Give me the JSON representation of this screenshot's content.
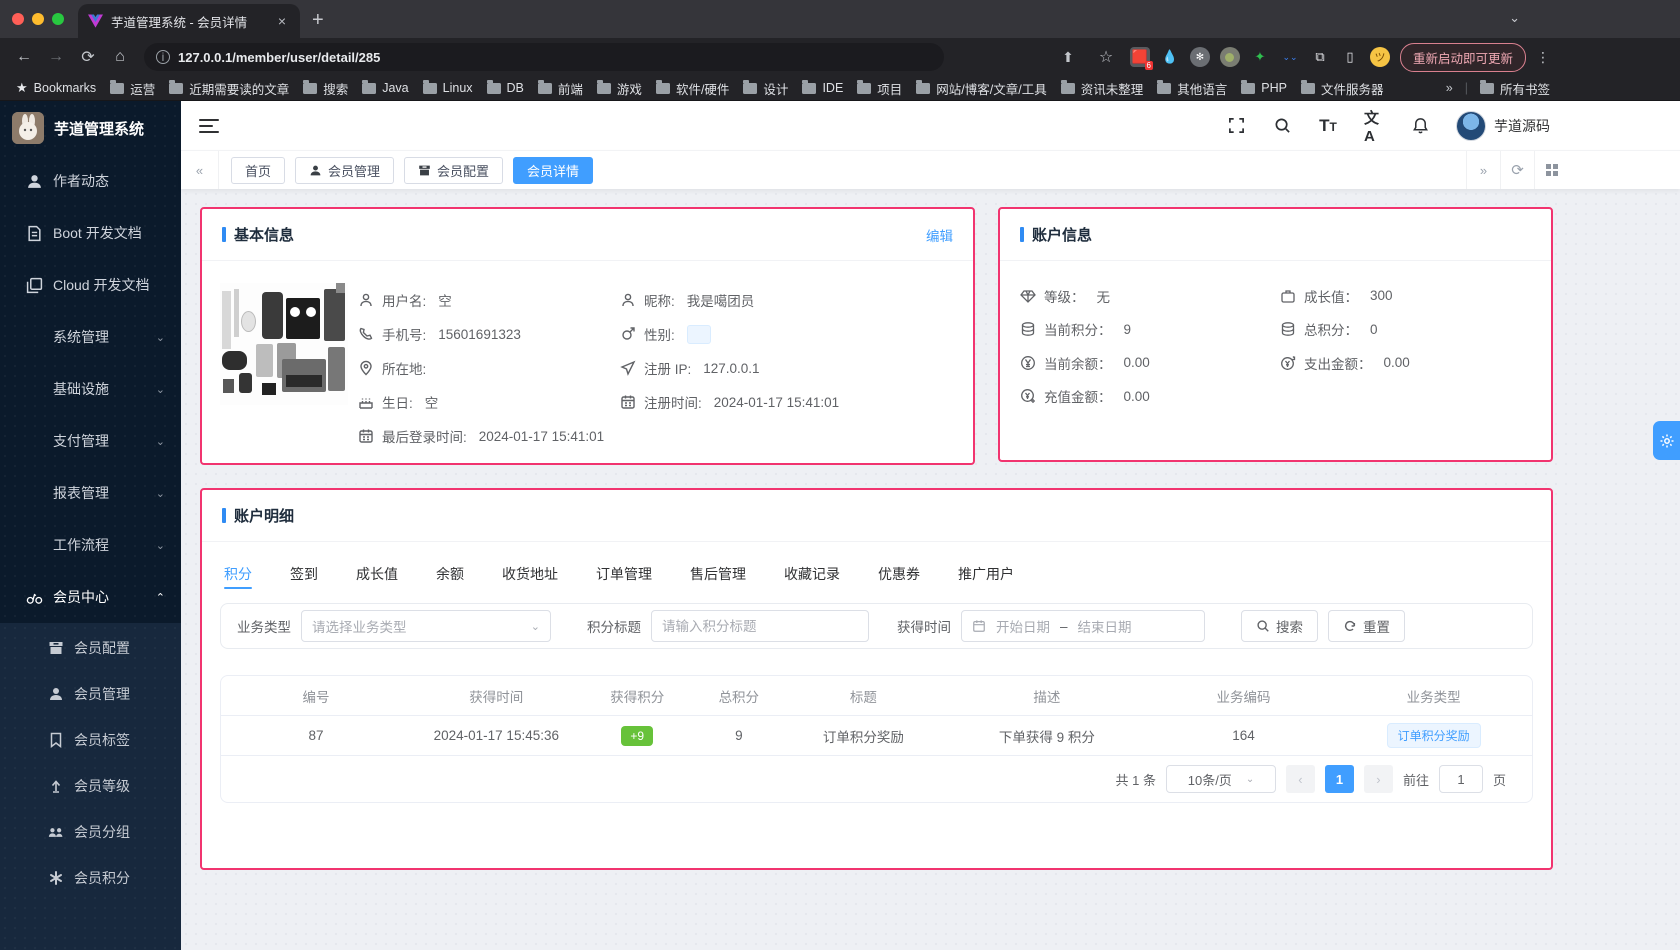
{
  "browser": {
    "tab_title": "芋道管理系统 - 会员详情",
    "close_tab": "×",
    "new_tab": "+",
    "url": "127.0.0.1/member/user/detail/285",
    "update_button": "重新启动即可更新",
    "bookmarks_label": "Bookmarks",
    "bookmark_folders": [
      "运营",
      "近期需要读的文章",
      "搜索",
      "Java",
      "Linux",
      "DB",
      "前端",
      "游戏",
      "软件/硬件",
      "设计",
      "IDE",
      "项目",
      "网站/博客/文章/工具",
      "资讯未整理",
      "其他语言",
      "PHP",
      "文件服务器"
    ],
    "overflow_chevron": "»",
    "all_bookmarks": "所有书签"
  },
  "sidebar": {
    "app_title": "芋道管理系统",
    "items": [
      {
        "label": "作者动态"
      },
      {
        "label": "Boot 开发文档"
      },
      {
        "label": "Cloud 开发文档"
      },
      {
        "label": "系统管理"
      },
      {
        "label": "基础设施"
      },
      {
        "label": "支付管理"
      },
      {
        "label": "报表管理"
      },
      {
        "label": "工作流程"
      },
      {
        "label": "会员中心"
      }
    ],
    "submenu": [
      {
        "label": "会员配置"
      },
      {
        "label": "会员管理"
      },
      {
        "label": "会员标签"
      },
      {
        "label": "会员等级"
      },
      {
        "label": "会员分组"
      },
      {
        "label": "会员积分"
      }
    ]
  },
  "navbar": {
    "font_icon": "Tt",
    "translate_icon": "文A",
    "username": "芋道源码"
  },
  "tags": {
    "items": [
      {
        "label": "首页"
      },
      {
        "label": "会员管理"
      },
      {
        "label": "会员配置"
      },
      {
        "label": "会员详情",
        "active": true
      }
    ]
  },
  "basic_info": {
    "title": "基本信息",
    "edit_label": "编辑",
    "fields": [
      {
        "label": "用户名:",
        "value": "空"
      },
      {
        "label": "昵称:",
        "value": "我是噶团员"
      },
      {
        "label": "手机号:",
        "value": "15601691323"
      },
      {
        "label": "性别:",
        "value": ""
      },
      {
        "label": "所在地:",
        "value": ""
      },
      {
        "label": "注册 IP:",
        "value": "127.0.0.1"
      },
      {
        "label": "生日:",
        "value": "空"
      },
      {
        "label": "注册时间:",
        "value": "2024-01-17 15:41:01"
      },
      {
        "label": "最后登录时间:",
        "value": "2024-01-17 15:41:01"
      }
    ]
  },
  "account_info": {
    "title": "账户信息",
    "fields": [
      {
        "label": "等级：",
        "value": "无"
      },
      {
        "label": "成长值：",
        "value": "300"
      },
      {
        "label": "当前积分：",
        "value": "9"
      },
      {
        "label": "总积分：",
        "value": "0"
      },
      {
        "label": "当前余额：",
        "value": "0.00"
      },
      {
        "label": "支出金额：",
        "value": "0.00"
      },
      {
        "label": "充值金额：",
        "value": "0.00"
      }
    ]
  },
  "account_detail": {
    "title": "账户明细",
    "tabs": [
      {
        "label": "积分",
        "active": true
      },
      {
        "label": "签到"
      },
      {
        "label": "成长值"
      },
      {
        "label": "余额"
      },
      {
        "label": "收货地址"
      },
      {
        "label": "订单管理"
      },
      {
        "label": "售后管理"
      },
      {
        "label": "收藏记录"
      },
      {
        "label": "优惠券"
      },
      {
        "label": "推广用户"
      }
    ],
    "filters": {
      "type_label": "业务类型",
      "type_placeholder": "请选择业务类型",
      "title_label": "积分标题",
      "title_placeholder": "请输入积分标题",
      "time_label": "获得时间",
      "start_placeholder": "开始日期",
      "range_separator": "–",
      "end_placeholder": "结束日期",
      "search_label": "搜索",
      "reset_label": "重置"
    },
    "table": {
      "columns": [
        "编号",
        "获得时间",
        "获得积分",
        "总积分",
        "标题",
        "描述",
        "业务编码",
        "业务类型"
      ],
      "row": {
        "id": "87",
        "time": "2024-01-17 15:45:36",
        "gain": "+9",
        "total": "9",
        "title": "订单积分奖励",
        "desc": "下单获得 9 积分",
        "code": "164",
        "type": "订单积分奖励"
      }
    },
    "pagination": {
      "total": "共 1 条",
      "page_size": "10条/页",
      "page": "1",
      "goto_prefix": "前往",
      "goto_value": "1",
      "goto_suffix": "页"
    }
  },
  "colors": {
    "primary": "#409eff",
    "highlight": "#f1346f",
    "success": "#67c23a"
  }
}
